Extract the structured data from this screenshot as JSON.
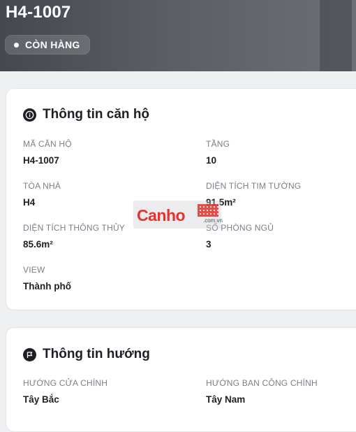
{
  "header": {
    "title": "H4-1007",
    "status_badge": "CÒN HÀNG"
  },
  "apartment_info": {
    "title": "Thông tin căn hộ",
    "icon": "info-icon",
    "fields": [
      {
        "label": "MÃ CĂN HỘ",
        "value": "H4-1007"
      },
      {
        "label": "TẦNG",
        "value": "10"
      },
      {
        "label": "TÒA NHÀ",
        "value": "H4"
      },
      {
        "label": "DIỆN TÍCH TIM TƯỜNG",
        "value": "91.5m²"
      },
      {
        "label": "DIỆN TÍCH THÔNG THỦY",
        "value": "85.6m²"
      },
      {
        "label": "SỐ PHÒNG NGỦ",
        "value": "3"
      },
      {
        "label": "VIEW",
        "value": "Thành phố"
      }
    ]
  },
  "direction_info": {
    "title": "Thông tin hướng",
    "icon": "flag-icon",
    "fields": [
      {
        "label": "HƯỚNG CỬA CHÍNH",
        "value": "Tây Bắc"
      },
      {
        "label": "HƯỚNG BAN CÔNG CHÍNH",
        "value": "Tây Nam"
      }
    ]
  },
  "watermark": {
    "brand": "Canho",
    "domain": ".com.vn"
  },
  "colors": {
    "header_bg": "#4f5259",
    "watermark_red": "#e5322d",
    "label_gray": "#7a7e87"
  }
}
